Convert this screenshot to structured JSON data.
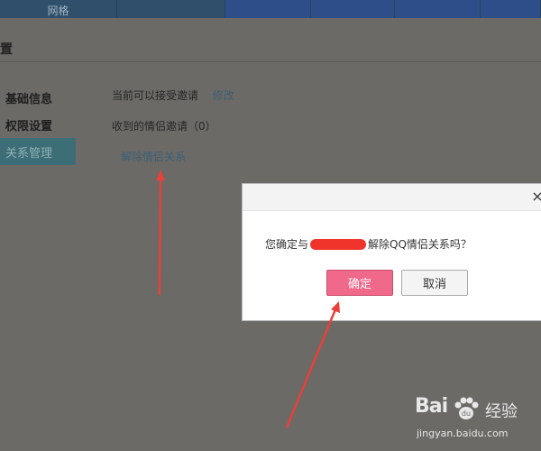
{
  "topnav": {
    "tabs": [
      "网格",
      "",
      "",
      "",
      "",
      ""
    ]
  },
  "page": {
    "title": "置"
  },
  "sidebar": {
    "items": [
      {
        "label": "基础信息"
      },
      {
        "label": "权限设置"
      },
      {
        "label": "关系管理"
      }
    ]
  },
  "content": {
    "invite_status": "当前可以接受邀请",
    "modify_link": "修改",
    "received": "收到的情侣邀请（0）",
    "unlink": "解除情侣关系"
  },
  "dialog": {
    "close": "×",
    "message_prefix": "您确定与",
    "message_suffix": "解除QQ情侣关系吗？",
    "confirm_label": "确定",
    "cancel_label": "取消"
  },
  "watermark": {
    "logo": "Bai",
    "logo_suffix": "经验",
    "url": "jingyan.baidu.com"
  },
  "colors": {
    "arrow": "#e8403a",
    "confirm": "#f0688a",
    "sidebar_active": "#3d6e78"
  }
}
